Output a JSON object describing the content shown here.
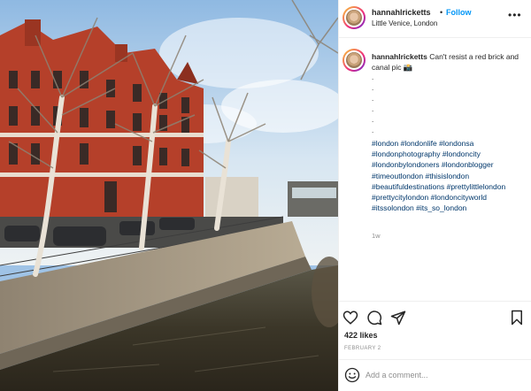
{
  "post": {
    "author": {
      "username": "hannahlricketts",
      "separator": "•",
      "follow_label": "Follow",
      "location": "Little Venice, London"
    },
    "more_icon": "more-options-icon",
    "caption": {
      "username": "hannahlricketts",
      "text": "Can't resist a red brick and canal pic 📸",
      "dots": [
        ".",
        ".",
        ".",
        ".",
        ".",
        "."
      ],
      "hashtags": "#london #londonlife #londonsa #londonphotography #londoncity #londonbylondoners #londonblogger #timeoutlondon #thisislondon #beautifuldestinations #prettylittlelondon #prettycitylondon #londoncityworld #itssolondon #its_so_london"
    },
    "time_ago": "1w",
    "actions": {
      "like_icon": "heart-icon",
      "comment_icon": "comment-icon",
      "share_icon": "share-icon",
      "save_icon": "bookmark-icon"
    },
    "likes": "422 likes",
    "date": "FEBRUARY 2",
    "comment": {
      "emoji_icon": "emoji-icon",
      "placeholder": "Add a comment..."
    }
  },
  "colors": {
    "link": "#0095f6",
    "hashtag": "#00376b",
    "muted": "#8e8e8e",
    "brick": "#b5402a",
    "water": "#2e2a22"
  }
}
